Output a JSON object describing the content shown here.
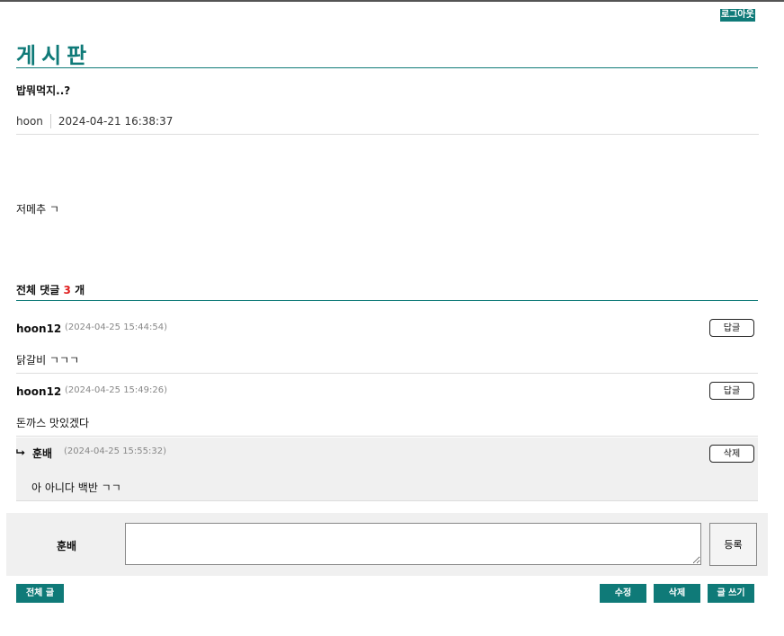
{
  "header": {
    "logout_label": "로그아웃",
    "board_title": "게시판"
  },
  "post": {
    "title": "밥뭐먹지..?",
    "author": "hoon",
    "datetime": "2024-04-21 16:38:37",
    "body": "저메추 ㄱ"
  },
  "comments_section": {
    "prefix": "전체 댓글",
    "count": "3",
    "suffix": "개"
  },
  "comments": [
    {
      "author": "hoon12",
      "date": "(2024-04-25 15:44:54)",
      "text": "닭갈비 ㄱㄱㄱ",
      "button": "답글"
    },
    {
      "author": "hoon12",
      "date": "(2024-04-25 15:49:26)",
      "text": "돈까스 맛있겠다",
      "button": "답글"
    },
    {
      "author": "훈배",
      "date": "(2024-04-25 15:55:32)",
      "text": "아 아니다 백반 ㄱㄱ",
      "button": "삭제",
      "reply_marker": "⮡"
    }
  ],
  "comment_form": {
    "username": "훈배",
    "value": "",
    "submit_label": "등록"
  },
  "footer": {
    "list_label": "전체 글",
    "edit_label": "수정",
    "delete_label": "삭제",
    "write_label": "글 쓰기"
  },
  "colors": {
    "accent": "#0f7a78",
    "count_red": "#e02020"
  }
}
